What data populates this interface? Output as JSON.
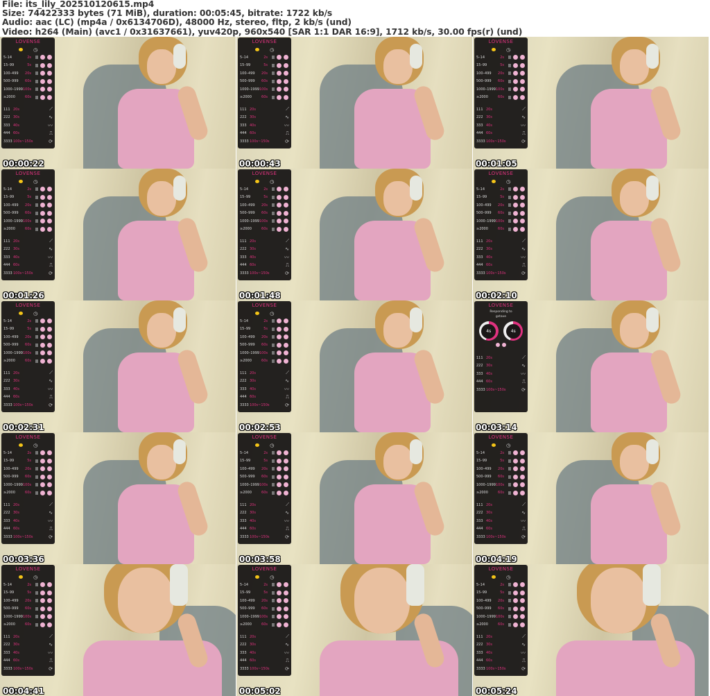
{
  "header": {
    "lines": [
      "File: its_lily_202510120615.mp4",
      "Size: 74422333 bytes (71 MiB), duration: 00:05:45, bitrate: 1722 kb/s",
      "Audio: aac (LC) (mp4a / 0x6134706D), 48000 Hz, stereo, fltp, 2 kb/s (und)",
      "Video: h264 (Main) (avc1 / 0x31637661), yuv420p, 960x540 [SAR 1:1 DAR 16:9], 1712 kb/s, 30.00 fps(r) (und)"
    ]
  },
  "panel": {
    "logo": "LOVENSE",
    "levels": [
      [
        "5–14",
        "2s"
      ],
      [
        "15–99",
        "5s"
      ],
      [
        "100–499",
        "20s"
      ],
      [
        "500–999",
        "60s"
      ],
      [
        "1000–1999",
        "100s"
      ],
      [
        "≥2000",
        "60s"
      ]
    ],
    "patterns": [
      [
        "111",
        "20s",
        "⟋"
      ],
      [
        "222",
        "30s",
        "∿"
      ],
      [
        "333",
        "40s",
        "〰"
      ],
      [
        "444",
        "60s",
        "⎍"
      ],
      [
        "3333",
        "100s~150s",
        "⟳"
      ]
    ],
    "responding_label": "Responding to",
    "responding_user": "gstave",
    "ring_value": "4s"
  },
  "thumbnails": [
    {
      "time": "00:00:22",
      "panel": "levels",
      "shot": "wide"
    },
    {
      "time": "00:00:43",
      "panel": "levels",
      "shot": "wide"
    },
    {
      "time": "00:01:05",
      "panel": "levels",
      "shot": "wide"
    },
    {
      "time": "00:01:26",
      "panel": "levels",
      "shot": "wide"
    },
    {
      "time": "00:01:48",
      "panel": "levels",
      "shot": "wide"
    },
    {
      "time": "00:02:10",
      "panel": "levels",
      "shot": "wide"
    },
    {
      "time": "00:02:31",
      "panel": "levels",
      "shot": "wide"
    },
    {
      "time": "00:02:53",
      "panel": "levels",
      "shot": "wide"
    },
    {
      "time": "00:03:14",
      "panel": "responding",
      "shot": "wide"
    },
    {
      "time": "00:03:36",
      "panel": "levels",
      "shot": "wide"
    },
    {
      "time": "00:03:58",
      "panel": "levels",
      "shot": "wide"
    },
    {
      "time": "00:04:19",
      "panel": "levels",
      "shot": "wide"
    },
    {
      "time": "00:04:41",
      "panel": "levels",
      "shot": "close"
    },
    {
      "time": "00:05:02",
      "panel": "levels",
      "shot": "close"
    },
    {
      "time": "00:05:24",
      "panel": "levels",
      "shot": "close"
    }
  ]
}
